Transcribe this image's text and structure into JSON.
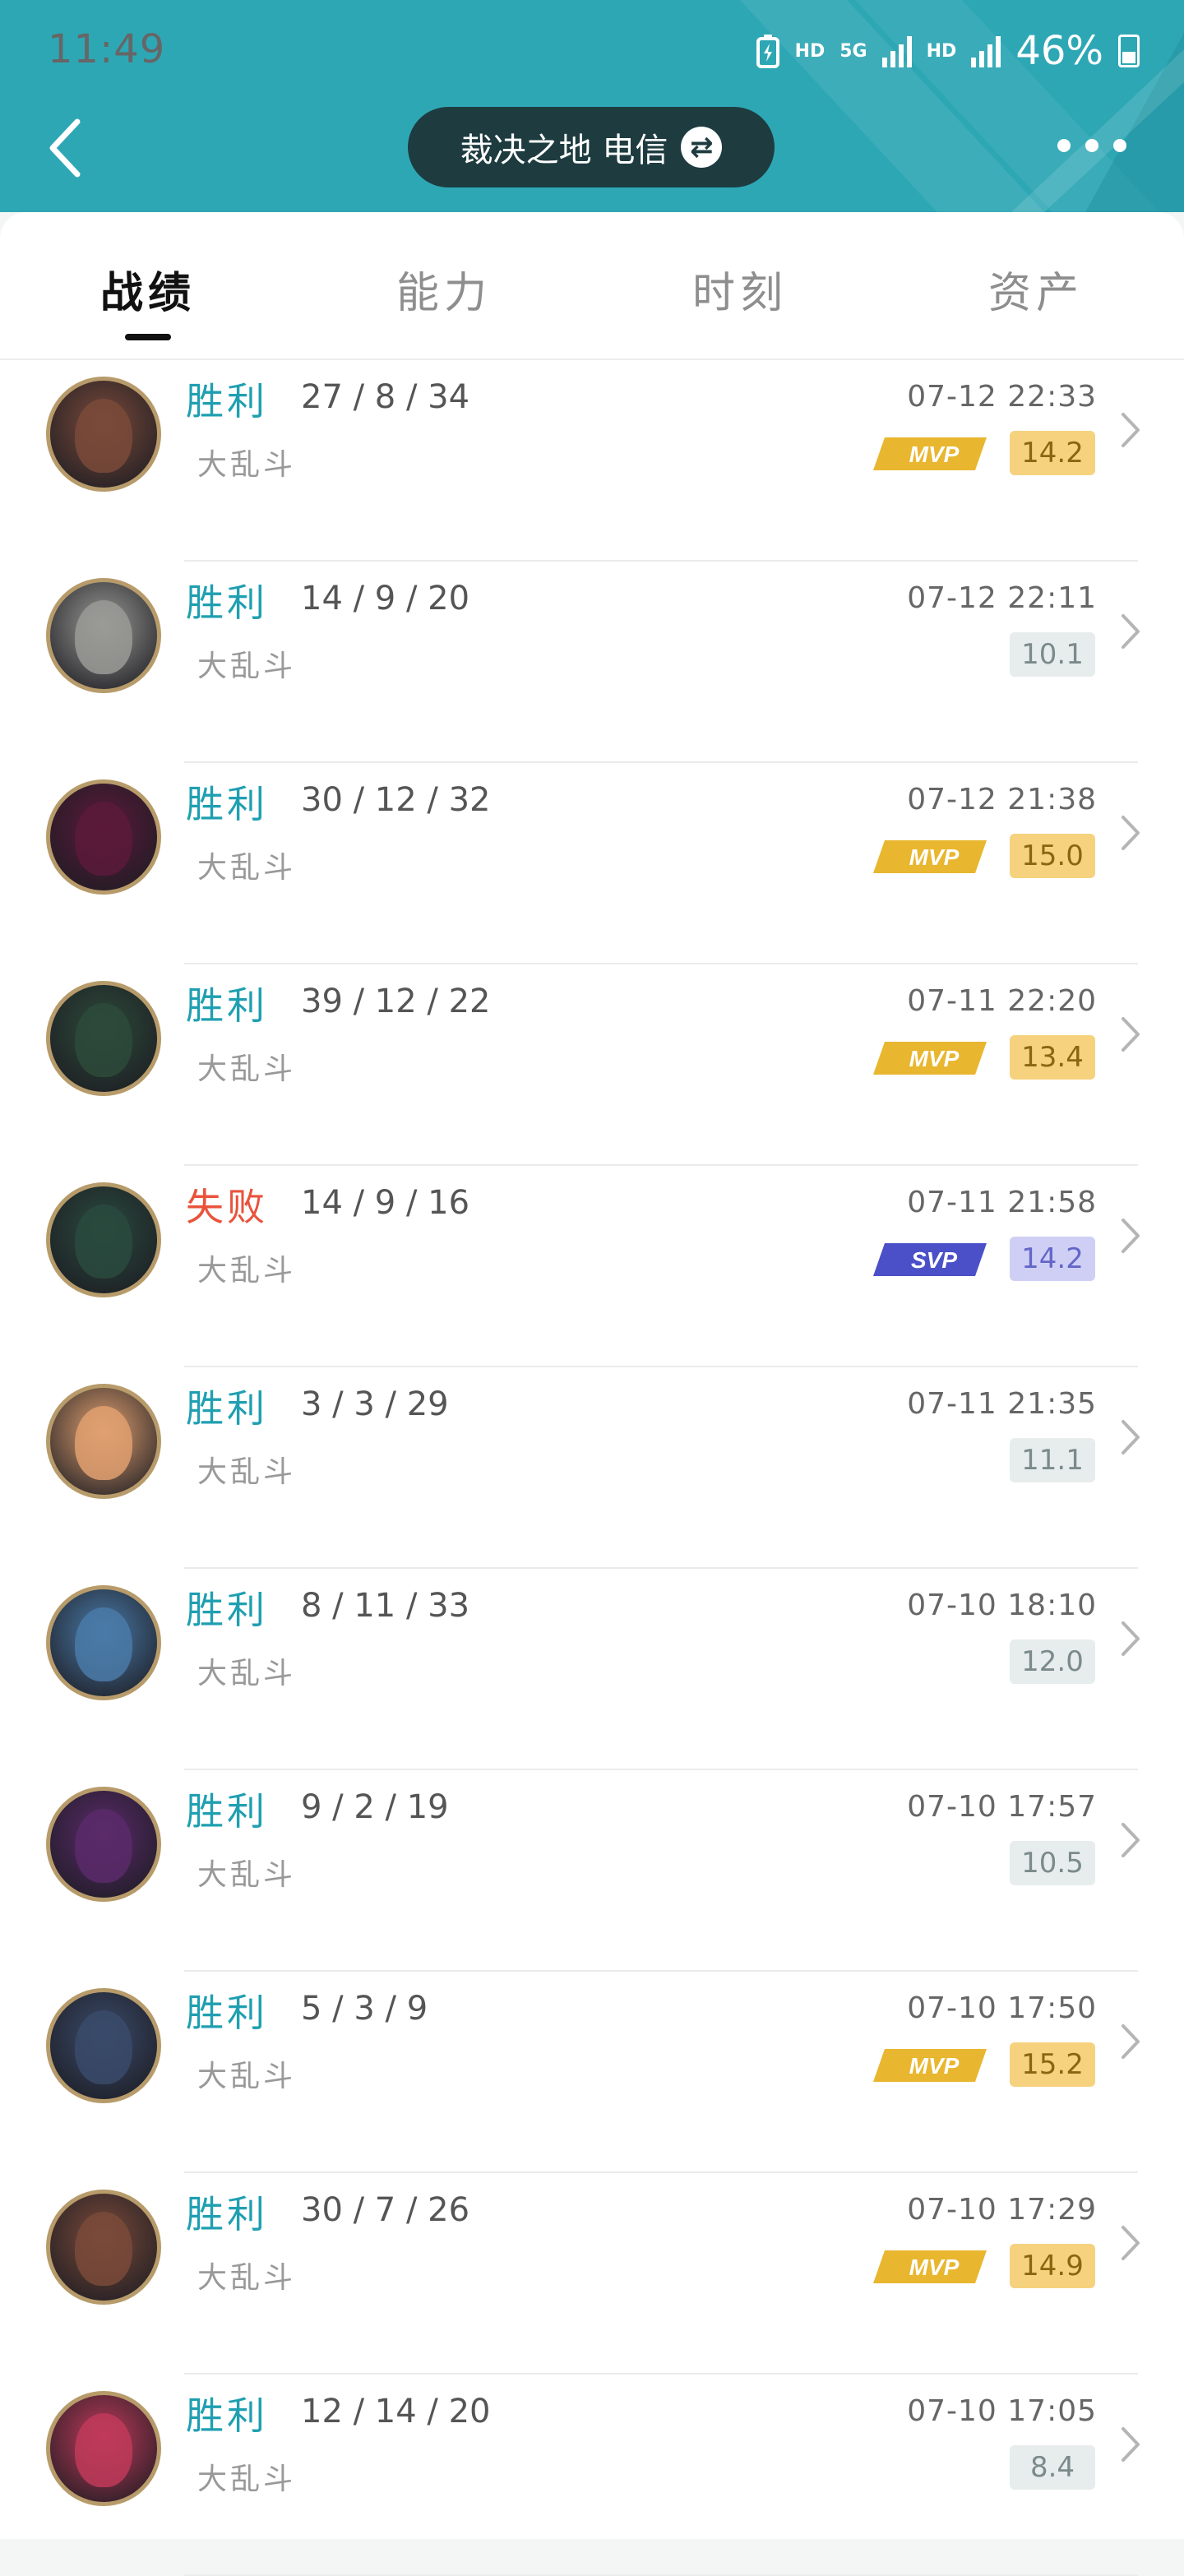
{
  "status_bar": {
    "time": "11:49",
    "hd1": "HD",
    "net": "5G",
    "hd2": "HD",
    "battery": "46%"
  },
  "header": {
    "server_label": "裁决之地 电信",
    "swap_symbol": "⇄"
  },
  "tabs": [
    {
      "label": "战绩",
      "active": true
    },
    {
      "label": "能力",
      "active": false
    },
    {
      "label": "时刻",
      "active": false
    },
    {
      "label": "资产",
      "active": false
    }
  ],
  "matches": [
    {
      "result": "胜利",
      "outcome": "win",
      "kda": "27 / 8 / 34",
      "mode": "大乱斗",
      "time": "07-12 22:33",
      "badge": "MVP",
      "score": "14.2",
      "hero_color": "#7a4a3a"
    },
    {
      "result": "胜利",
      "outcome": "win",
      "kda": "14 / 9 / 20",
      "mode": "大乱斗",
      "time": "07-12 22:11",
      "badge": "",
      "score": "10.1",
      "hero_color": "#9a9a96"
    },
    {
      "result": "胜利",
      "outcome": "win",
      "kda": "30 / 12 / 32",
      "mode": "大乱斗",
      "time": "07-12 21:38",
      "badge": "MVP",
      "score": "15.0",
      "hero_color": "#5b1a3a"
    },
    {
      "result": "胜利",
      "outcome": "win",
      "kda": "39 / 12 / 22",
      "mode": "大乱斗",
      "time": "07-11 22:20",
      "badge": "MVP",
      "score": "13.4",
      "hero_color": "#2d4a3a"
    },
    {
      "result": "失败",
      "outcome": "loss",
      "kda": "14 / 9 / 16",
      "mode": "大乱斗",
      "time": "07-11 21:58",
      "badge": "SVP",
      "score": "14.2",
      "hero_color": "#2a4a3e"
    },
    {
      "result": "胜利",
      "outcome": "win",
      "kda": "3 / 3 / 29",
      "mode": "大乱斗",
      "time": "07-11 21:35",
      "badge": "",
      "score": "11.1",
      "hero_color": "#e0a070"
    },
    {
      "result": "胜利",
      "outcome": "win",
      "kda": "8 / 11 / 33",
      "mode": "大乱斗",
      "time": "07-10 18:10",
      "badge": "",
      "score": "12.0",
      "hero_color": "#4a7aa8"
    },
    {
      "result": "胜利",
      "outcome": "win",
      "kda": "9 / 2 / 19",
      "mode": "大乱斗",
      "time": "07-10 17:57",
      "badge": "",
      "score": "10.5",
      "hero_color": "#5a2a6a"
    },
    {
      "result": "胜利",
      "outcome": "win",
      "kda": "5 / 3 / 9",
      "mode": "大乱斗",
      "time": "07-10 17:50",
      "badge": "MVP",
      "score": "15.2",
      "hero_color": "#3a4a6a"
    },
    {
      "result": "胜利",
      "outcome": "win",
      "kda": "30 / 7 / 26",
      "mode": "大乱斗",
      "time": "07-10 17:29",
      "badge": "MVP",
      "score": "14.9",
      "hero_color": "#7a4a3a"
    },
    {
      "result": "胜利",
      "outcome": "win",
      "kda": "12 / 14 / 20",
      "mode": "大乱斗",
      "time": "07-10 17:05",
      "badge": "",
      "score": "8.4",
      "hero_color": "#c03a5a"
    }
  ],
  "colors": {
    "header": "#2ea7b5",
    "win": "#1f9fb1",
    "loss": "#e9533c",
    "mvp": "#e8b62f",
    "svp": "#4b50c8"
  }
}
